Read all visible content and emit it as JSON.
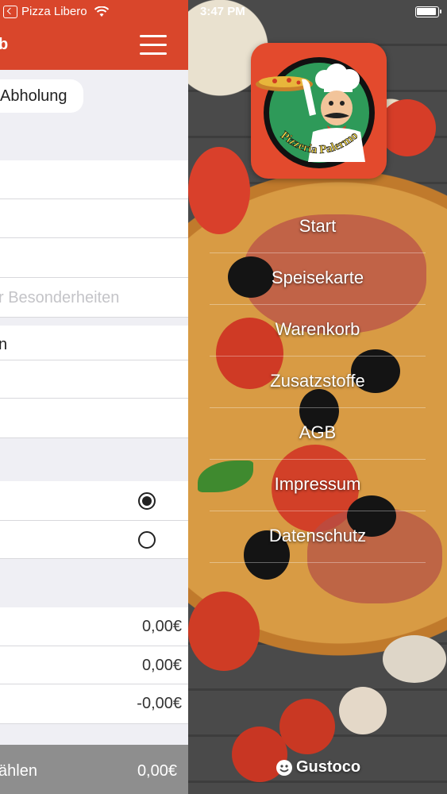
{
  "status_left": {
    "carrier": "Pizza Libero"
  },
  "status_right": {
    "time": "3:47 PM"
  },
  "cart": {
    "title": "b",
    "pickup_label": "Abholung",
    "notes_placeholder": "r Besonderheiten",
    "row_text": "n",
    "radio_options": [
      {
        "selected": true
      },
      {
        "selected": false
      }
    ],
    "amounts": [
      "0,00€",
      "0,00€",
      "-0,00€"
    ],
    "bottom_label": "ählen",
    "bottom_total": "0,00€"
  },
  "logo": {
    "brand": "Pizzeria Palermo"
  },
  "menu": {
    "items": [
      "Start",
      "Speisekarte",
      "Warenkorb",
      "Zusatzstoffe",
      "AGB",
      "Impressum",
      "Datenschutz"
    ]
  },
  "footer": {
    "brand": "Gustoco"
  },
  "colors": {
    "accent": "#d9462b",
    "logo_bg": "#e34a2d"
  }
}
